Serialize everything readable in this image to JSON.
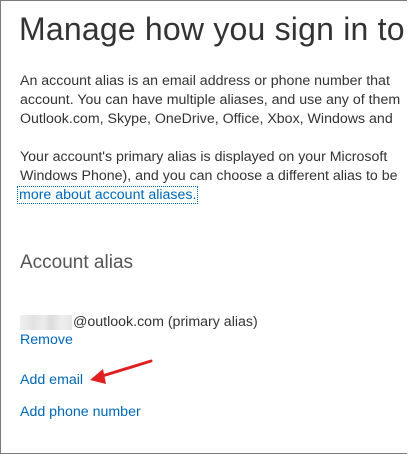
{
  "page": {
    "title": "Manage how you sign in to"
  },
  "intro": {
    "line1": "An account alias is an email address or phone number that",
    "line2": "account. You can have multiple aliases, and use any of them",
    "line3": "Outlook.com, Skype, OneDrive, Office, Xbox, Windows and"
  },
  "primary": {
    "line1": "Your account's primary alias is displayed on your Microsoft",
    "line2": "Windows Phone), and you can choose a different alias to be",
    "link": "more about account aliases."
  },
  "alias_section": {
    "heading": "Account alias",
    "alias_suffix": "@outlook.com (primary alias)",
    "remove_label": "Remove",
    "add_email_label": "Add email",
    "add_phone_label": "Add phone number"
  },
  "annotation": {
    "arrow_color": "#e02020"
  },
  "colors": {
    "link": "#0067b8",
    "text": "#333333"
  }
}
